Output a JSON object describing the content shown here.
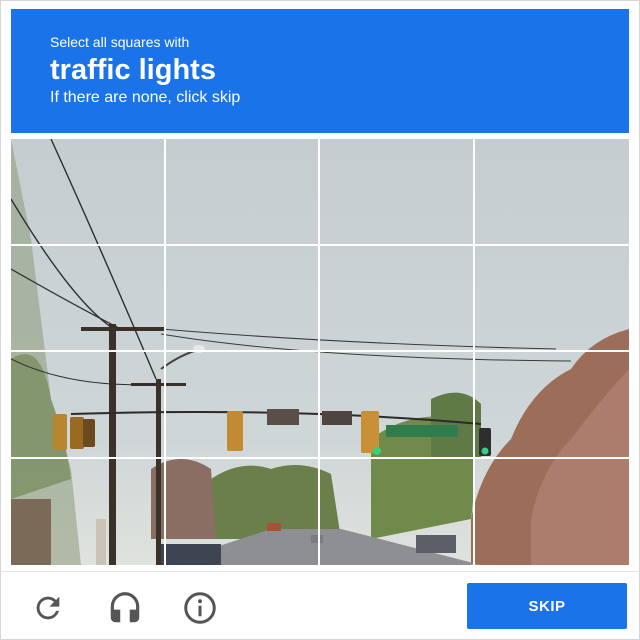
{
  "header": {
    "instruction": "Select all squares with",
    "target": "traffic lights",
    "hint": "If there are none, click skip"
  },
  "grid": {
    "rows": 4,
    "columns": 4,
    "tiles": [
      {
        "row": 1,
        "col": 1
      },
      {
        "row": 1,
        "col": 2
      },
      {
        "row": 1,
        "col": 3
      },
      {
        "row": 1,
        "col": 4
      },
      {
        "row": 2,
        "col": 1
      },
      {
        "row": 2,
        "col": 2
      },
      {
        "row": 2,
        "col": 3
      },
      {
        "row": 2,
        "col": 4
      },
      {
        "row": 3,
        "col": 1
      },
      {
        "row": 3,
        "col": 2
      },
      {
        "row": 3,
        "col": 3
      },
      {
        "row": 3,
        "col": 4
      },
      {
        "row": 4,
        "col": 1
      },
      {
        "row": 4,
        "col": 2
      },
      {
        "row": 4,
        "col": 3
      },
      {
        "row": 4,
        "col": 4
      }
    ]
  },
  "footer": {
    "reload_icon": "reload-icon",
    "audio_icon": "headphones-icon",
    "info_icon": "info-icon",
    "skip_label": "SKIP"
  },
  "colors": {
    "accent": "#1a73e8",
    "icon": "#555555",
    "sky": "#c9d0d3"
  }
}
